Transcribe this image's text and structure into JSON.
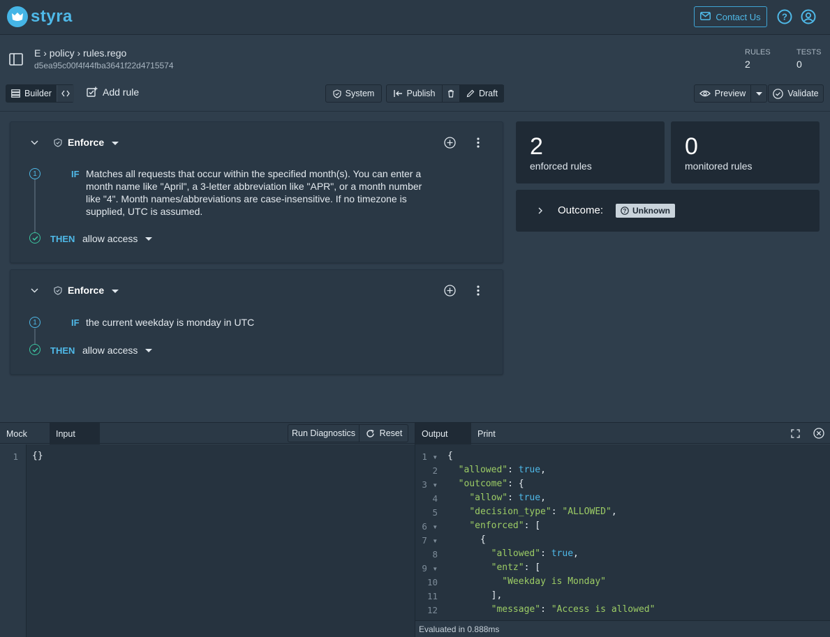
{
  "brand": {
    "name": "styra"
  },
  "topbar": {
    "contact_label": "Contact Us"
  },
  "header": {
    "breadcrumb": "E › policy › rules.rego",
    "hash": "d5ea95c00f4f44fba3641f22d4715574",
    "rules_label": "RULES",
    "rules_value": "2",
    "tests_label": "TESTS",
    "tests_value": "0"
  },
  "toolbar": {
    "builder_label": "Builder",
    "add_rule_label": "Add rule",
    "system_label": "System",
    "publish_label": "Publish",
    "draft_label": "Draft",
    "preview_label": "Preview",
    "validate_label": "Validate"
  },
  "rules": [
    {
      "type_label": "Enforce",
      "step": "1",
      "if_kw": "IF",
      "condition": "Matches all requests that occur within the specified month(s). You can enter a month name like \"April\", a 3-letter abbreviation like \"APR\", or a month number like \"4\". Month names/abbreviations are case-insensitive. If no timezone is supplied, UTC is assumed.",
      "then_kw": "THEN",
      "action": "allow access"
    },
    {
      "type_label": "Enforce",
      "step": "1",
      "if_kw": "IF",
      "condition": "the current weekday is monday in UTC",
      "then_kw": "THEN",
      "action": "allow access"
    }
  ],
  "stats": {
    "enforced_value": "2",
    "enforced_label": "enforced rules",
    "monitored_value": "0",
    "monitored_label": "monitored rules"
  },
  "outcome": {
    "label": "Outcome:",
    "badge": "Unknown"
  },
  "bottom": {
    "mock_tab": "Mock",
    "input_tab": "Input",
    "run_diagnostics": "Run Diagnostics",
    "reset": "Reset",
    "output_tab": "Output",
    "print_tab": "Print",
    "input_lines": [
      "{}"
    ],
    "status": "Evaluated in 0.888ms"
  },
  "output_lines": [
    "{",
    "  \"allowed\": true,",
    "  \"outcome\": {",
    "    \"allow\": true,",
    "    \"decision_type\": \"ALLOWED\",",
    "    \"enforced\": [",
    "      {",
    "        \"allowed\": true,",
    "        \"entz\": [",
    "          \"Weekday is Monday\"",
    "        ],",
    "        \"message\": \"Access is allowed\""
  ],
  "colors": {
    "accent": "#4fb9e8",
    "success": "#3cc4a0",
    "background": "#2f3e4c"
  }
}
